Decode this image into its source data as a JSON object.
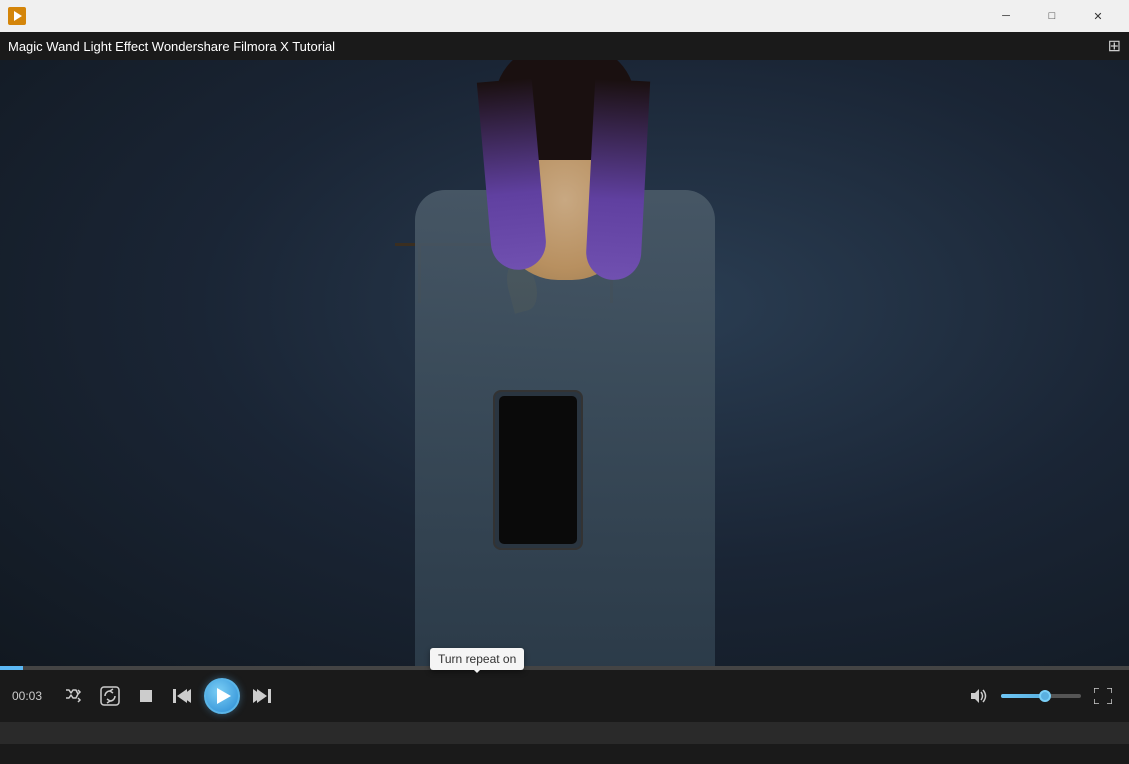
{
  "titlebar": {
    "app_title": "Magic Wand Light Effect  Wondershare Filmora X Tutorial",
    "min_label": "─",
    "max_label": "□",
    "close_label": "✕"
  },
  "menubar": {
    "video_title": "Magic Wand Light Effect  Wondershare Filmora X Tutorial",
    "grid_icon": "⊞"
  },
  "controls": {
    "time": "00:03",
    "shuffle_icon": "⇄",
    "stop_icon": "■",
    "prev_icon": "◀◀",
    "next_icon": "▶▶",
    "volume_icon": "🔊",
    "volume_percent": 55,
    "fullscreen_icon": "⤢"
  },
  "tooltip": {
    "text": "Turn repeat on"
  },
  "progress": {
    "percent": 2
  }
}
